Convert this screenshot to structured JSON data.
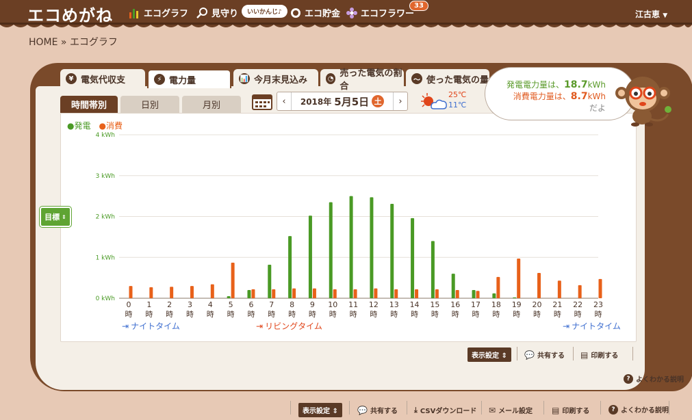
{
  "app": {
    "logo": "エコめがね",
    "nav": [
      {
        "label": "エコグラフ",
        "icon": "bar-graph-icon"
      },
      {
        "label": "見守り",
        "icon": "magnifier-icon"
      },
      {
        "label": "エコ貯金",
        "icon": "piggy-icon"
      },
      {
        "label": "エコフラワー",
        "icon": "flower-icon"
      }
    ],
    "bubble": "いいかんじ♪",
    "flower_count": "33",
    "user": "江古恵"
  },
  "breadcrumb": "HOME » エコグラフ",
  "tabs": [
    {
      "label": "電気代収支",
      "icon": "¥"
    },
    {
      "label": "電力量",
      "icon": "⚡"
    },
    {
      "label": "今月末見込み",
      "icon": "📊"
    },
    {
      "label": "売った電気の割合",
      "icon": "◔"
    },
    {
      "label": "使った電気の量",
      "icon": "〜"
    }
  ],
  "subtabs": [
    "時間帯別",
    "日別",
    "月別"
  ],
  "date": {
    "prefix": "2018年",
    "main": "5月5日",
    "dow": "土",
    "prev": "‹",
    "next": "›"
  },
  "weather": {
    "high": "25℃",
    "low": "11℃"
  },
  "speech": {
    "gen_prefix": "発電電力量は、",
    "gen_value": "18.7",
    "gen_unit": "kWh",
    "use_prefix": "消費電力量は、",
    "use_value": "8.7",
    "use_unit": "kWh",
    "tail": "だよ"
  },
  "legend": {
    "gen": "●発電",
    "use": "●消費"
  },
  "goal_button": "目標",
  "time_zones": {
    "night_left": "ナイトタイム",
    "living": "リビングタイム",
    "night_right": "ナイトタイム"
  },
  "actions_inner": {
    "display": "表示設定",
    "share": "共有する",
    "print": "印刷する"
  },
  "help_inner": "よくわかる説明",
  "actions_bottom": {
    "display": "表示設定",
    "share": "共有する",
    "csv": "CSVダウンロード",
    "mail": "メール設定",
    "print": "印刷する",
    "help": "よくわかる説明"
  },
  "colors": {
    "gen": "#4a9a25",
    "use": "#e8611a",
    "brown": "#6b3f24"
  },
  "chart_data": {
    "type": "bar",
    "categories": [
      "0",
      "1",
      "2",
      "3",
      "4",
      "5",
      "6",
      "7",
      "8",
      "9",
      "10",
      "11",
      "12",
      "13",
      "14",
      "15",
      "16",
      "17",
      "18",
      "19",
      "20",
      "21",
      "22",
      "23"
    ],
    "hour_suffix": "時",
    "ytick_labels": [
      "0 kWh",
      "1 kWh",
      "2 kWh",
      "3 kWh",
      "4 kWh"
    ],
    "ylim": [
      0,
      4
    ],
    "series": [
      {
        "name": "発電",
        "color": "#4a9a25",
        "values": [
          0,
          0,
          0,
          0,
          0,
          0.05,
          0.2,
          0.82,
          1.52,
          2.02,
          2.35,
          2.5,
          2.47,
          2.31,
          1.96,
          1.4,
          0.6,
          0.2,
          0.12,
          0.02,
          0,
          0,
          0,
          0
        ]
      },
      {
        "name": "消費",
        "color": "#e8611a",
        "values": [
          0.3,
          0.27,
          0.28,
          0.3,
          0.34,
          0.87,
          0.22,
          0.22,
          0.24,
          0.24,
          0.22,
          0.22,
          0.24,
          0.22,
          0.22,
          0.22,
          0.2,
          0.18,
          0.52,
          0.97,
          0.62,
          0.43,
          0.32,
          0.47
        ]
      }
    ],
    "grid": true
  }
}
